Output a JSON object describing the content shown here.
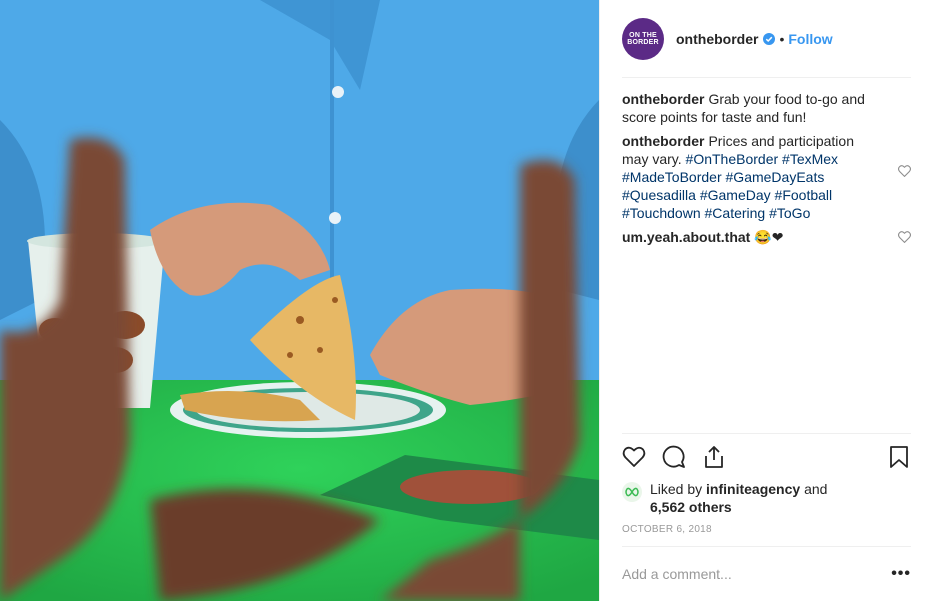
{
  "post": {
    "author": {
      "username": "ontheborder",
      "avatar_text_line1": "ON THE",
      "avatar_text_line2": "BORDER",
      "avatar_color": "#5b2a86",
      "verified": true
    },
    "separator": "•",
    "follow_label": "Follow",
    "comments": [
      {
        "username": "ontheborder",
        "text": "Grab your food to-go and score points for taste and fun!"
      },
      {
        "username": "ontheborder",
        "text": "Prices and participation may vary.",
        "hashtags": [
          "#OnTheBorder",
          "#TexMex",
          "#MadeToBorder",
          "#GameDayEats",
          "#Quesadilla",
          "#GameDay",
          "#Football",
          "#Touchdown",
          "#Catering",
          "#ToGo"
        ]
      },
      {
        "username": "um.yeah.about.that",
        "text": "😂❤"
      }
    ],
    "likes": {
      "prefix": "Liked by",
      "user": "infiniteagency",
      "joiner": "and",
      "others": "6,562 others"
    },
    "date": "OCTOBER 6, 2018",
    "add_comment_placeholder": "Add a comment...",
    "more_label": "•••"
  },
  "icons": [
    "heart-icon",
    "comment-icon",
    "share-icon",
    "bookmark-icon",
    "verified-badge-icon",
    "more-options-icon"
  ],
  "colors": {
    "link_blue": "#3897f0",
    "hashtag": "#003569",
    "divider": "#efefef",
    "muted": "#999999"
  }
}
